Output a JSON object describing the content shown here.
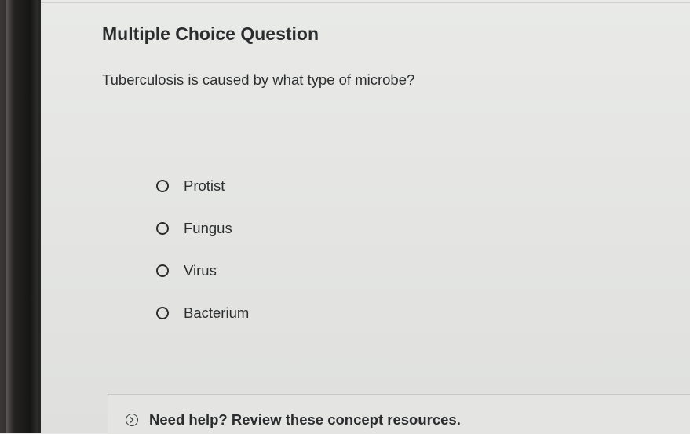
{
  "question": {
    "type_label": "Multiple Choice Question",
    "prompt": "Tuberculosis is caused by what type of microbe?",
    "options": [
      {
        "label": "Protist",
        "selected": false
      },
      {
        "label": "Fungus",
        "selected": false
      },
      {
        "label": "Virus",
        "selected": false
      },
      {
        "label": "Bacterium",
        "selected": false
      }
    ]
  },
  "help": {
    "icon": "chevron-right-circle-icon",
    "text": "Need help? Review these concept resources."
  }
}
